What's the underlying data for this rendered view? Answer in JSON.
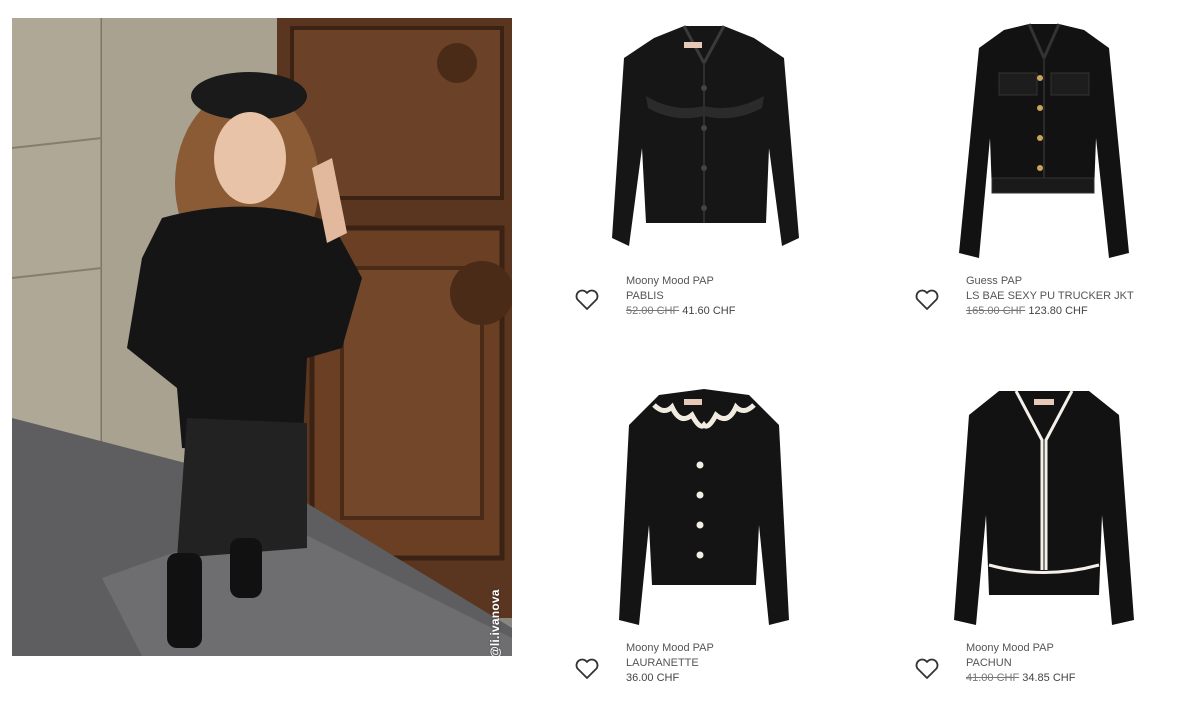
{
  "hero": {
    "credit": "@li.ivanova"
  },
  "products": [
    {
      "brand": "Moony Mood PAP",
      "name": "PABLIS",
      "old_price": "52.00 CHF",
      "price": "41.60 CHF"
    },
    {
      "brand": "Guess PAP",
      "name": "LS BAE SEXY PU TRUCKER JKT",
      "old_price": "165.00 CHF",
      "price": "123.80 CHF"
    },
    {
      "brand": "Moony Mood PAP",
      "name": "LAURANETTE",
      "old_price": "",
      "price": "36.00 CHF"
    },
    {
      "brand": "Moony Mood PAP",
      "name": "PACHUN",
      "old_price": "41.00 CHF",
      "price": "34.85 CHF"
    }
  ],
  "icons": {
    "wishlist": "heart-outline-icon"
  },
  "colors": {
    "text": "#555555",
    "garment": "#141414",
    "accent_trim": "#f2ece0"
  }
}
